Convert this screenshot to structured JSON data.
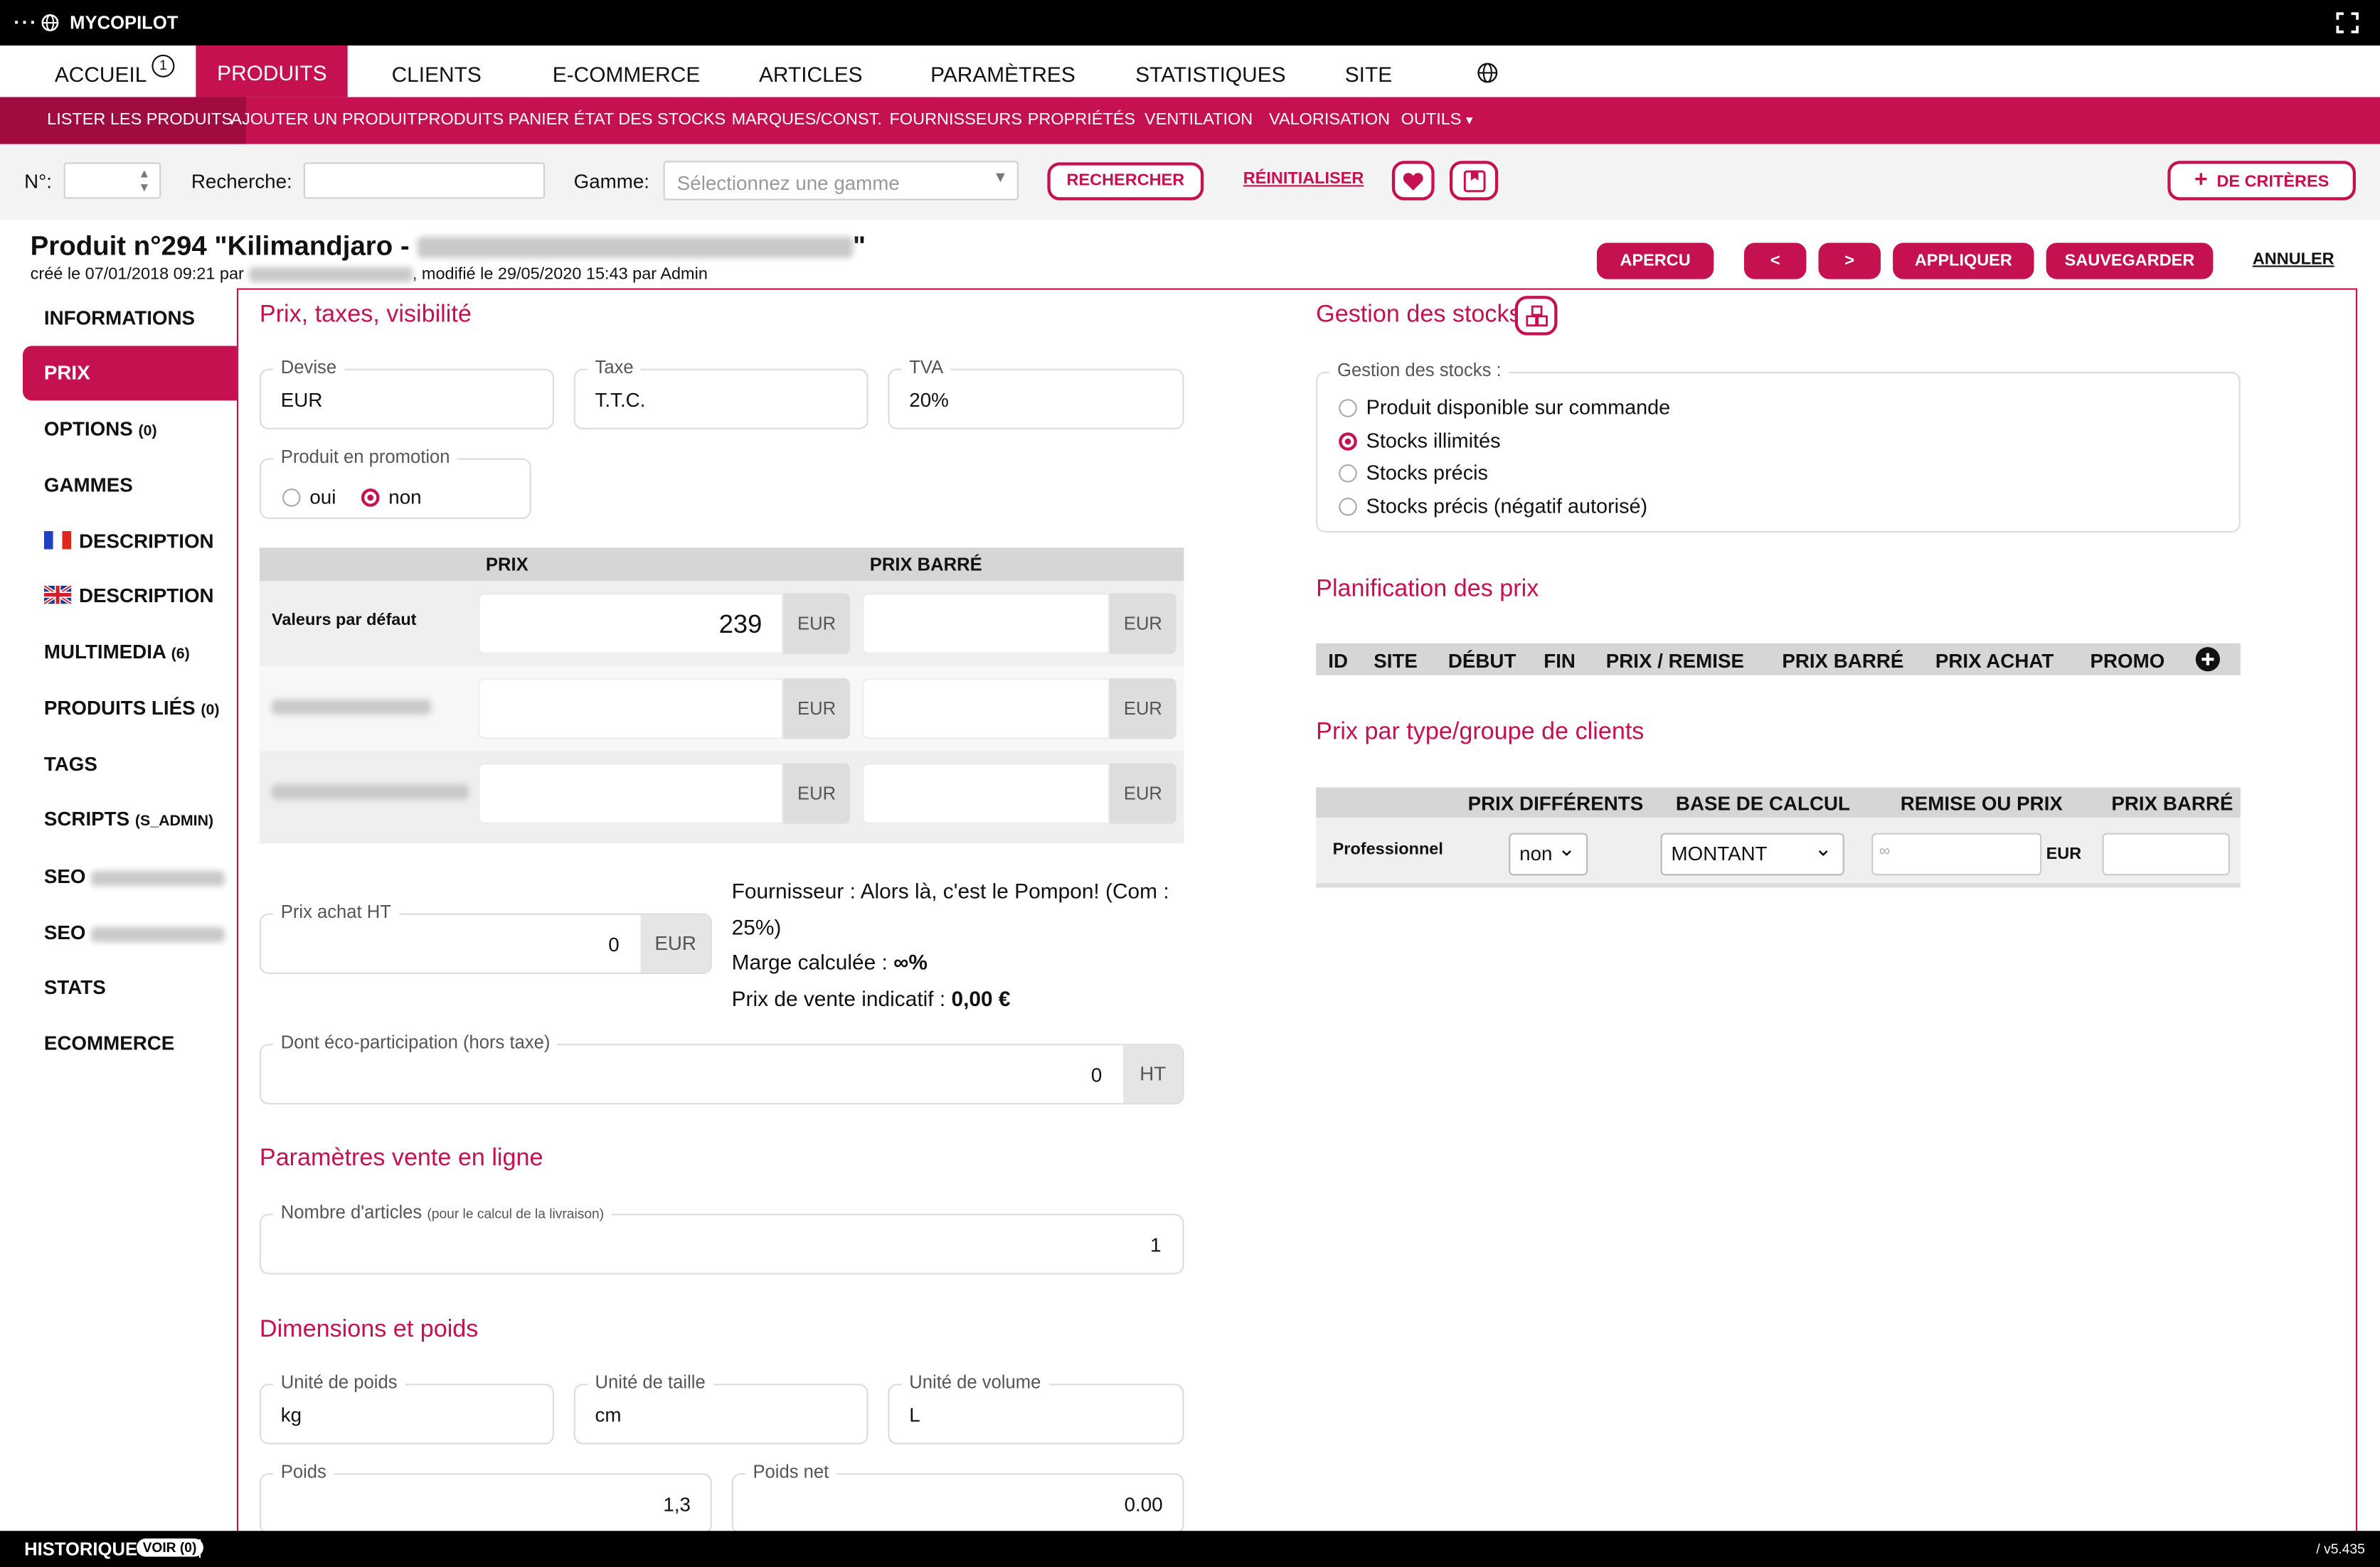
{
  "app": {
    "name": "MYCOPILOT"
  },
  "main_nav": [
    {
      "label": "ACCUEIL",
      "badge": "1"
    },
    {
      "label": "PRODUITS"
    },
    {
      "label": "CLIENTS"
    },
    {
      "label": "E-COMMERCE"
    },
    {
      "label": "ARTICLES"
    },
    {
      "label": "PARAMÈTRES"
    },
    {
      "label": "STATISTIQUES"
    },
    {
      "label": "SITE"
    }
  ],
  "sub_nav": [
    "LISTER LES PRODUITS",
    "AJOUTER UN PRODUIT",
    "PRODUITS PANIER",
    "ÉTAT DES STOCKS",
    "MARQUES/CONST.",
    "FOURNISSEURS",
    "PROPRIÉTÉS",
    "VENTILATION",
    "VALORISATION",
    "OUTILS"
  ],
  "search": {
    "num_label": "N°:",
    "search_label": "Recherche:",
    "gamme_label": "Gamme:",
    "gamme_placeholder": "Sélectionnez une gamme",
    "search_button": "RECHERCHER",
    "reset_button": "RÉINITIALISER",
    "criteria_button": "DE CRITÈRES"
  },
  "product": {
    "title": "Produit n°294 \"Kilimandjaro - ",
    "title_end": "\"",
    "created": "créé le 07/01/2018 09:21 par",
    "modified": ", modifié le 29/05/2020 15:43 par Admin"
  },
  "actions": {
    "preview": "APERCU",
    "prev": "<",
    "next": ">",
    "apply": "APPLIQUER",
    "save": "SAUVEGARDER",
    "cancel": "ANNULER"
  },
  "left_menu": [
    {
      "label": "INFORMATIONS"
    },
    {
      "label": "PRIX"
    },
    {
      "label": "OPTIONS",
      "count": "(0)"
    },
    {
      "label": "GAMMES"
    },
    {
      "label": "DESCRIPTION"
    },
    {
      "label": "DESCRIPTION"
    },
    {
      "label": "MULTIMEDIA",
      "count": "(6)"
    },
    {
      "label": "PRODUITS LIÉS",
      "count": "(0)"
    },
    {
      "label": "TAGS"
    },
    {
      "label": "SCRIPTS",
      "count": "(S_ADMIN)"
    },
    {
      "label": "SEO"
    },
    {
      "label": "SEO"
    },
    {
      "label": "STATS"
    },
    {
      "label": "ECOMMERCE"
    }
  ],
  "prices_section": {
    "title": "Prix, taxes, visibilité",
    "devise": {
      "label": "Devise",
      "value": "EUR"
    },
    "taxe": {
      "label": "Taxe",
      "value": "T.T.C."
    },
    "tva": {
      "label": "TVA",
      "value": "20%"
    },
    "promotion": {
      "label": "Produit en promotion",
      "yes": "oui",
      "no": "non",
      "selected": "non"
    },
    "table": {
      "col_price": "PRIX",
      "col_strike": "PRIX BARRÉ",
      "rows": [
        {
          "label": "Valeurs par défaut",
          "price": "239",
          "currency": "EUR",
          "strike_currency": "EUR"
        },
        {
          "label": "",
          "price": "",
          "currency": "EUR",
          "strike_currency": "EUR"
        },
        {
          "label": "",
          "price": "",
          "currency": "EUR",
          "strike_currency": "EUR"
        }
      ]
    },
    "purchase": {
      "label": "Prix achat HT",
      "value": "0",
      "currency": "EUR"
    },
    "supplier_info": {
      "supplier": "Fournisseur : Alors là, c'est le Pompon! (Com : 25%)",
      "margin_label": "Marge calculée : ",
      "margin_value": "∞%",
      "price_label": "Prix de vente indicatif : ",
      "price_value": "0,00 €"
    },
    "eco": {
      "label": "Dont éco-participation (hors taxe)",
      "value": "0",
      "unit": "HT"
    }
  },
  "online_section": {
    "title": "Paramètres vente en ligne",
    "articles": {
      "label": "Nombre d'articles",
      "hint": "(pour le calcul de la livraison)",
      "value": "1"
    }
  },
  "dimensions_section": {
    "title": "Dimensions et poids",
    "weight_unit": {
      "label": "Unité de poids",
      "value": "kg"
    },
    "size_unit": {
      "label": "Unité de taille",
      "value": "cm"
    },
    "volume_unit": {
      "label": "Unité de volume",
      "value": "L"
    },
    "weight": {
      "label": "Poids",
      "value": "1,3"
    },
    "net_weight": {
      "label": "Poids net",
      "value": "0.00"
    }
  },
  "stock_section": {
    "title": "Gestion des stocks",
    "legend": "Gestion des stocks :",
    "options": [
      "Produit disponible sur commande",
      "Stocks illimités",
      "Stocks précis",
      "Stocks précis (négatif autorisé)"
    ],
    "selected_index": 1
  },
  "planning_section": {
    "title": "Planification des prix",
    "columns": [
      "ID",
      "SITE",
      "DÉBUT",
      "FIN",
      "PRIX / REMISE",
      "PRIX BARRÉ",
      "PRIX ACHAT",
      "PROMO"
    ]
  },
  "client_price_section": {
    "title": "Prix par type/groupe de clients",
    "columns": [
      "PRIX DIFFÉRENTS",
      "BASE DE CALCUL",
      "REMISE OU PRIX",
      "PRIX BARRÉ"
    ],
    "row": {
      "label": "Professionnel",
      "different": "non",
      "base": "MONTANT",
      "placeholder": "∞",
      "currency": "EUR"
    }
  },
  "footer": {
    "history": "HISTORIQUE",
    "view": "VOIR (0)",
    "separator": "|",
    "version": "/ v5.435"
  },
  "colors": {
    "accent": "#c5114f",
    "accent_dark": "#a00c3f",
    "topbar": "#000000"
  }
}
